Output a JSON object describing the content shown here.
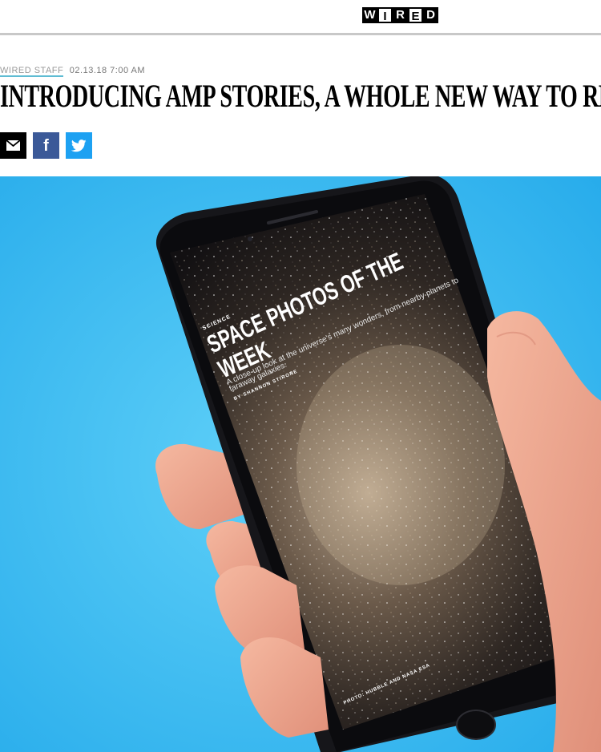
{
  "site": {
    "logo_letters": [
      "W",
      "I",
      "R",
      "E",
      "D"
    ]
  },
  "article": {
    "author": "WIRED STAFF",
    "date": "02.13.18 7:00 AM",
    "headline": "INTRODUCING AMP STORIES, A WHOLE NEW WAY TO RE"
  },
  "share": {
    "icons": [
      "email-icon",
      "facebook-icon",
      "twitter-icon"
    ],
    "facebook_glyph": "f"
  },
  "hero": {
    "story_kicker": "SCIENCE",
    "story_title_line1": "SPACE PHOTOS OF THE",
    "story_title_line2": "WEEK",
    "story_dek_line1": "A close-up look at the universe's many wonders, from nearby planets to",
    "story_dek_line2": "faraway galaxies.",
    "story_author": "BY SHANNON STIRONE",
    "photo_credit": "PHOTO: HUBBLE AND NASA ESA"
  },
  "colors": {
    "background_blue": "#35bbf2",
    "facebook": "#3b5998",
    "twitter": "#1da1f2",
    "author_underline": "#5fbcd3"
  }
}
